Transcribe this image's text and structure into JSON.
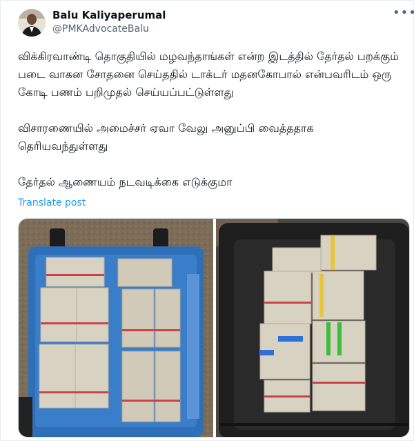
{
  "author": {
    "name": "Balu Kaliyaperumal",
    "handle": "@PMKAdvocateBalu"
  },
  "icons": {
    "more": "more-horizontal-icon",
    "avatar": "avatar-photo"
  },
  "post": {
    "paragraphs": [
      "விக்கிரவாண்டி தொகுதியில் மழவந்தாங்கள் என்ற இடத்தில் தேர்தல் பறக்கும் படை வாகன சோதனை செய்ததில் டாக்டர் மதனகோபால் என்பவரிடம் ஒரு கோடி பணம் பறிமுதல் செய்யப்பட்டுள்ளது",
      "விசாரணையில் அமைச்சர் ஏவா வேலு அனுப்பி வைத்ததாக தெரியவந்துள்ளது",
      "தேர்தல் ஆணையம் நடவடிக்கை எடுக்குமா"
    ],
    "translate_label": "Translate post"
  },
  "colors": {
    "link": "#1d9bf0",
    "secondary_text": "#536471",
    "suitcase_blue": "#2f6fb8",
    "suitcase_black": "#1e1e1f",
    "cash": "#d8d2c2"
  }
}
